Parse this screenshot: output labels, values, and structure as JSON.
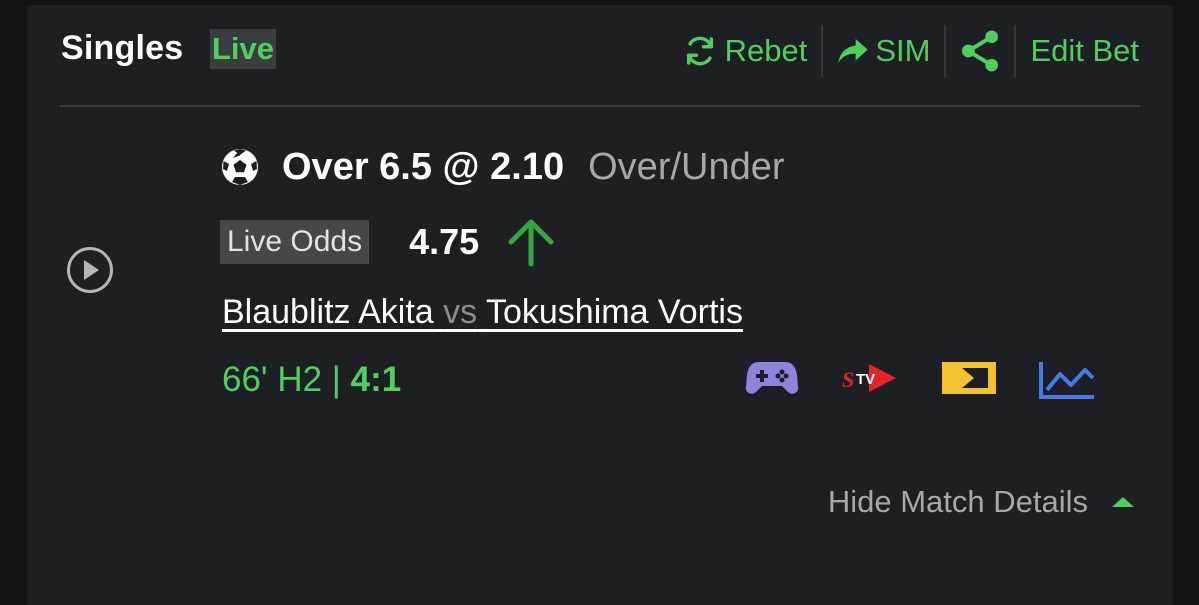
{
  "header": {
    "title": "Singles",
    "live_badge": "Live",
    "actions": {
      "rebet": "Rebet",
      "sim": "SIM",
      "edit_bet": "Edit Bet"
    }
  },
  "bet": {
    "selection": "Over 6.5 @ 2.10",
    "market": "Over/Under",
    "live_odds_label": "Live Odds",
    "live_odds_value": "4.75",
    "home_team": "Blaublitz Akita",
    "vs": "vs",
    "away_team": "Tokushima Vortis",
    "match_clock": "66' H2 | ",
    "score": "4:1"
  },
  "footer": {
    "hide_details": "Hide Match Details"
  },
  "icons": [
    "refresh-icon",
    "share-arrow-icon",
    "share-icon",
    "play-icon",
    "soccer-ball-icon",
    "arrow-up-icon",
    "gamepad-icon",
    "stv-icon",
    "tv-icon",
    "chart-icon",
    "caret-up-icon"
  ],
  "colors": {
    "accent_green": "#4fcf5b",
    "background": "#1e1f24",
    "muted_text": "#a7a8ab",
    "gamepad": "#8b84dc",
    "stv": "#e2252b",
    "tv": "#f2c230",
    "chart": "#3f7ee8"
  }
}
